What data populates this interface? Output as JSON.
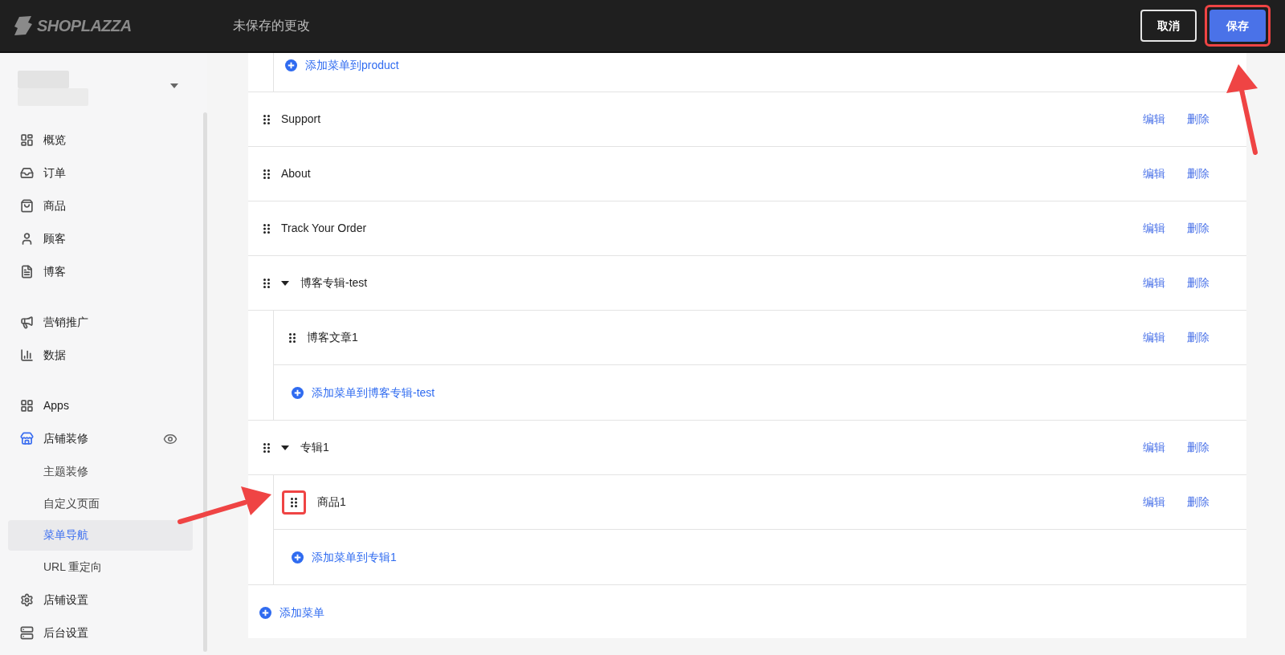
{
  "header": {
    "logo": "SHOPLAZZA",
    "title": "未保存的更改",
    "buttons": [
      {
        "kind": "secondary",
        "label": "取消",
        "annotated": false
      },
      {
        "kind": "primary",
        "label": "保存",
        "annotated": true
      }
    ]
  },
  "sidebar": {
    "groups": [
      [
        {
          "label": "概览"
        },
        {
          "label": "订单"
        },
        {
          "label": "商品"
        },
        {
          "label": "顾客"
        },
        {
          "label": "博客"
        }
      ],
      [
        {
          "label": "营销推广"
        },
        {
          "label": "数据"
        }
      ],
      [
        {
          "label": "Apps"
        },
        {
          "label": "店铺装修",
          "active": true,
          "children": [
            {
              "label": "主题装修",
              "selected": false
            },
            {
              "label": "自定义页面",
              "selected": false
            },
            {
              "label": "菜单导航",
              "selected": true
            },
            {
              "label": "URL 重定向",
              "selected": false
            }
          ]
        },
        {
          "label": "店铺设置"
        },
        {
          "label": "后台设置"
        }
      ]
    ]
  },
  "menu": {
    "continued_children": [
      {
        "kind": "add",
        "label": "添加菜单到product"
      }
    ],
    "items": [
      {
        "kind": "item",
        "label": "Support",
        "actions": [
          "编辑",
          "删除"
        ]
      },
      {
        "kind": "item",
        "label": "About",
        "actions": [
          "编辑",
          "删除"
        ]
      },
      {
        "kind": "item",
        "label": "Track Your Order",
        "actions": [
          "编辑",
          "删除"
        ]
      },
      {
        "kind": "item",
        "label": "博客专辑-test",
        "expanded": true,
        "actions": [
          "编辑",
          "删除"
        ],
        "children": [
          {
            "kind": "item",
            "label": "博客文章1",
            "actions": [
              "编辑",
              "删除"
            ]
          },
          {
            "kind": "add",
            "label": "添加菜单到博客专辑-test"
          }
        ]
      },
      {
        "kind": "item",
        "label": "专辑1",
        "expanded": true,
        "actions": [
          "编辑",
          "删除"
        ],
        "children": [
          {
            "kind": "item",
            "label": "商品1",
            "annotated": true,
            "actions": [
              "编辑",
              "删除"
            ]
          },
          {
            "kind": "add",
            "label": "添加菜单到专辑1"
          }
        ]
      }
    ],
    "add_menu": "添加菜单"
  }
}
